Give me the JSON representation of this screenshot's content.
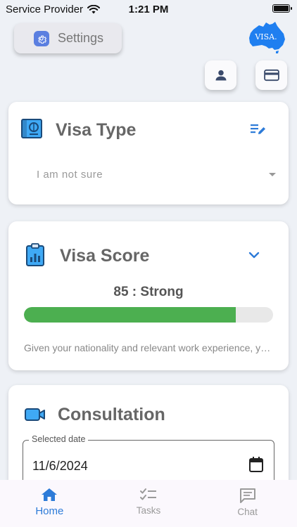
{
  "status_bar": {
    "carrier": "Service Provider",
    "time": "1:21 PM"
  },
  "header": {
    "settings_label": "Settings",
    "logo_text": "VISA."
  },
  "colors": {
    "accent": "#2d7bd8",
    "progress": "#4caf50",
    "gear_bg": "#5b7fe0"
  },
  "visa_type": {
    "title": "Visa Type",
    "dropdown_value": "I am not sure"
  },
  "visa_score": {
    "title": "Visa Score",
    "score_text": "85 : Strong",
    "score_percent": 85,
    "description": "Given your nationality and relevant work experience, your chances look promising."
  },
  "consultation": {
    "title": "Consultation",
    "date_label": "Selected date",
    "date_value": "11/6/2024"
  },
  "bottom_nav": {
    "items": [
      {
        "label": "Home",
        "icon": "home-icon"
      },
      {
        "label": "Tasks",
        "icon": "tasks-icon"
      },
      {
        "label": "Chat",
        "icon": "chat-icon"
      }
    ]
  }
}
